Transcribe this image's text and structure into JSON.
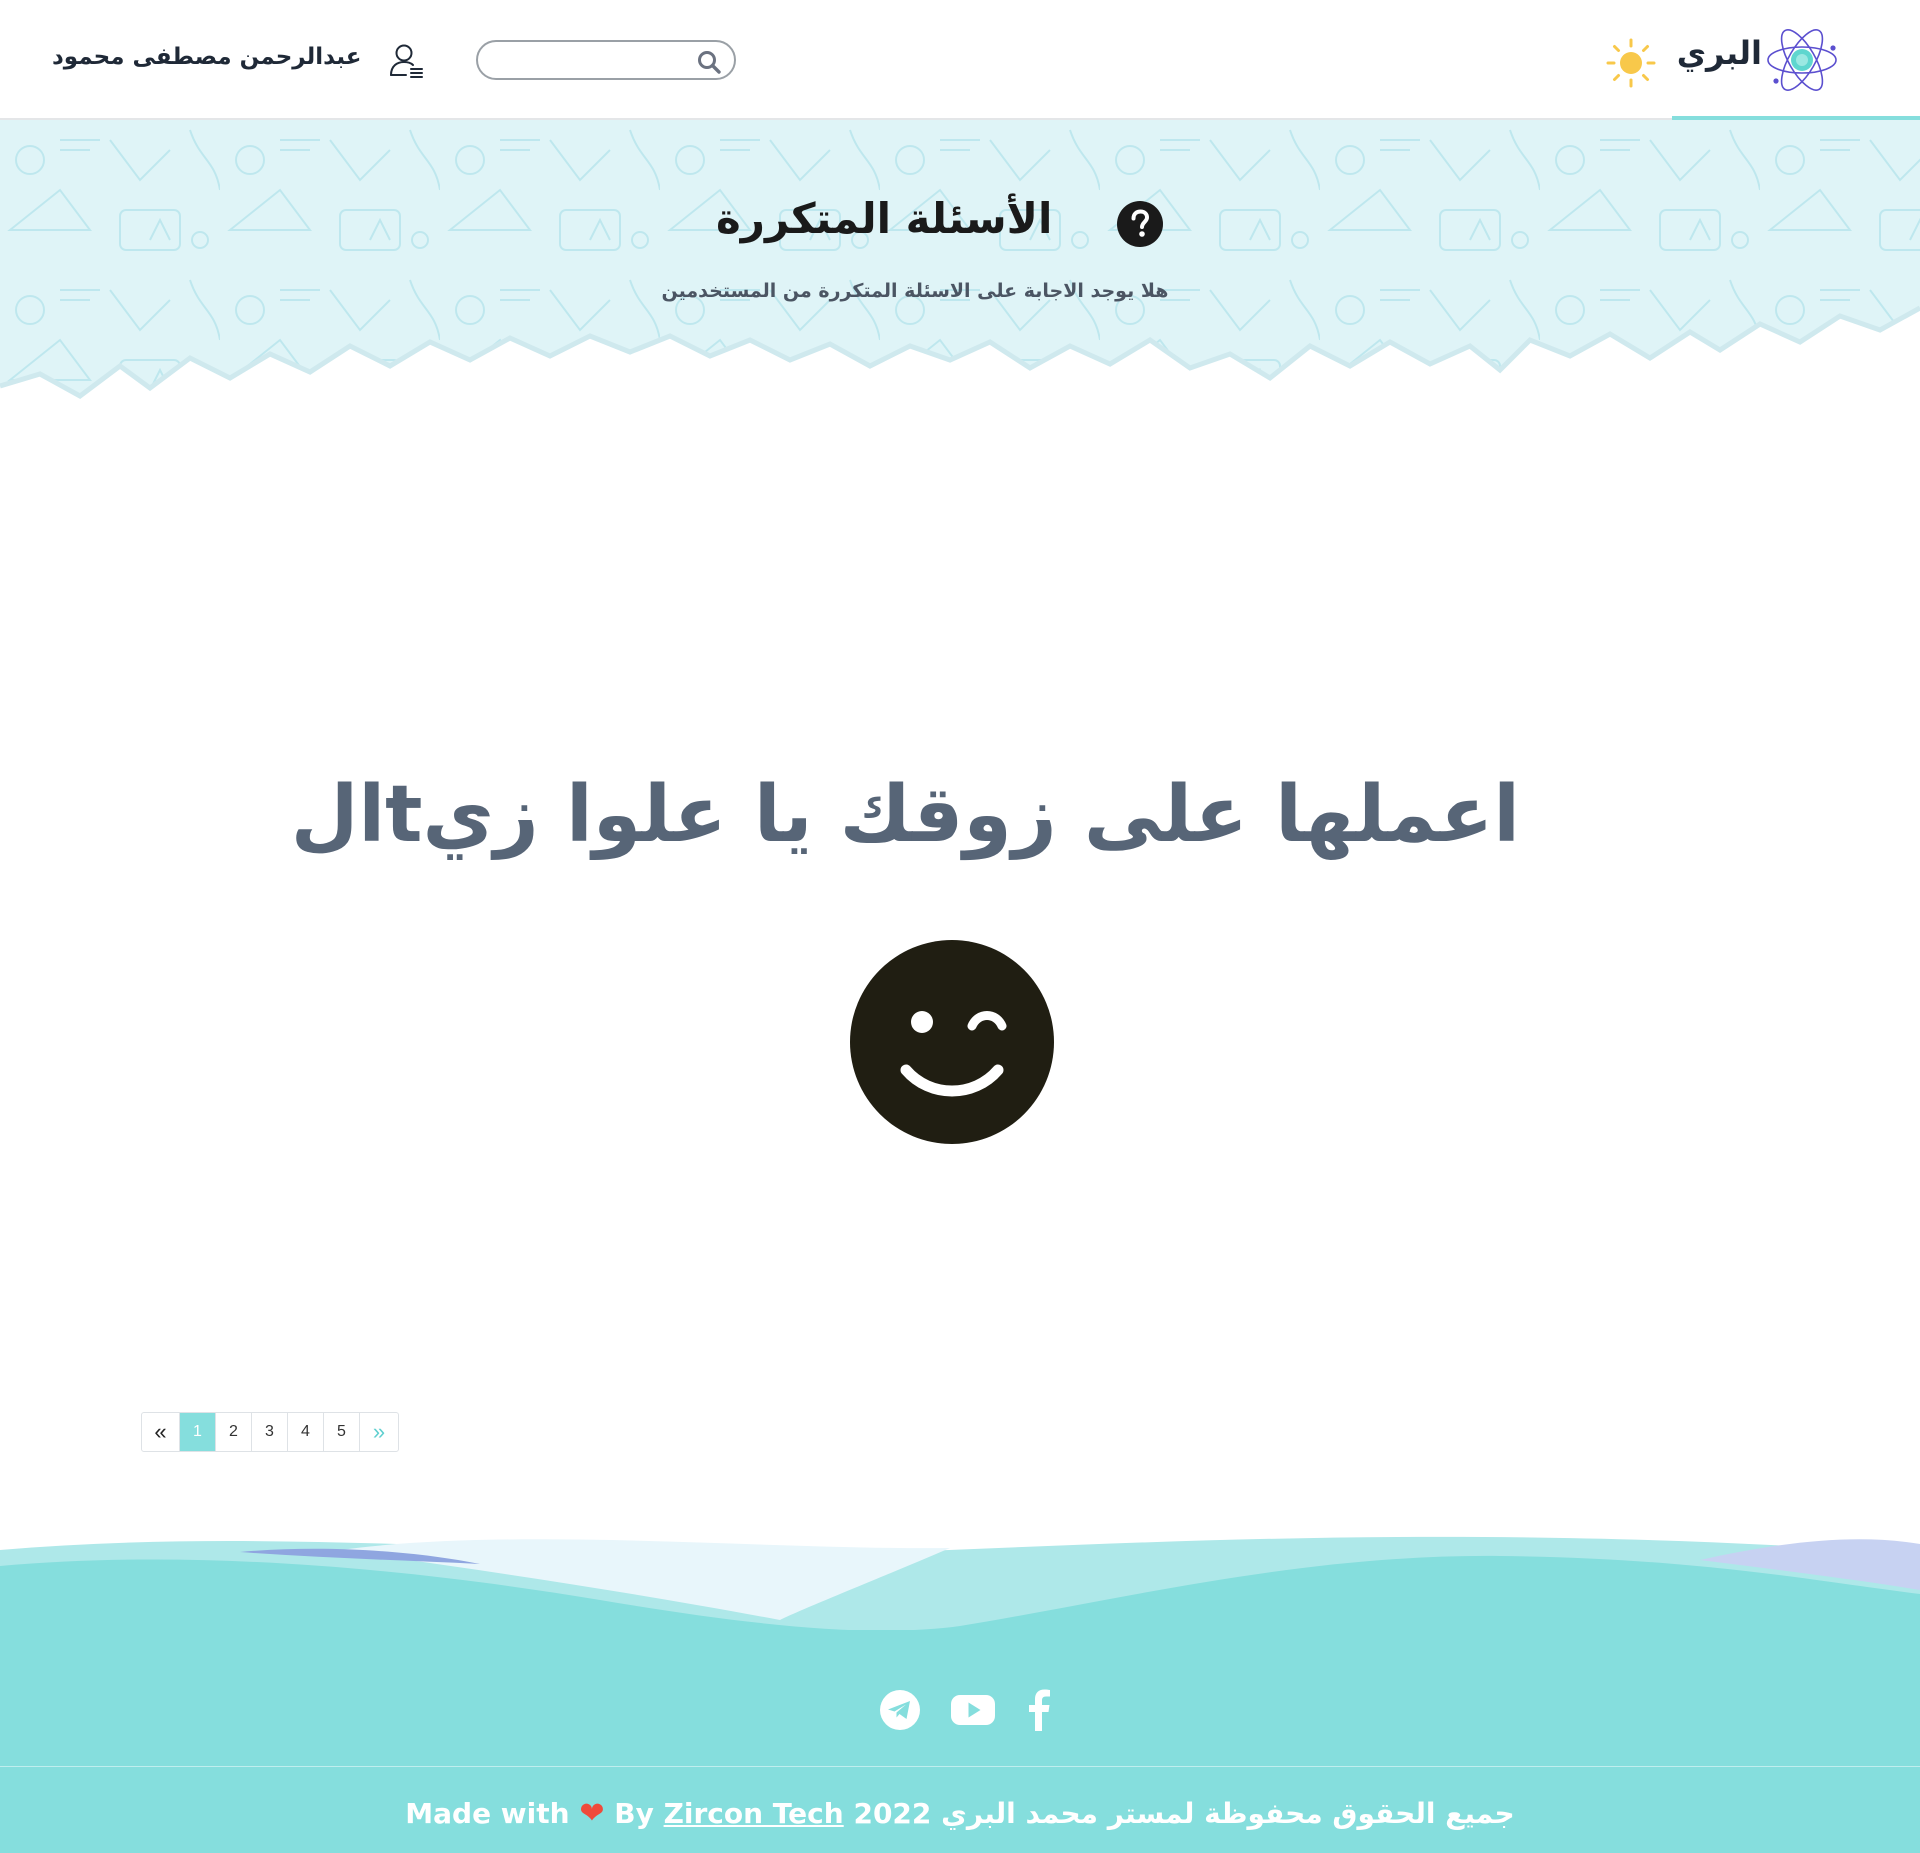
{
  "header": {
    "brand": "البري",
    "user_name": "عبدالرحمن مصطفى محمود",
    "search": {
      "placeholder": "",
      "value": ""
    },
    "icons": [
      "atom-logo-icon",
      "sun-icon",
      "search-icon",
      "user-list-icon"
    ]
  },
  "hero": {
    "title": "الأسئلة المتكررة",
    "subtitle": "هلا يوجد الاجابة على الاسئلة المتكررة من المستخدمين",
    "icon": "question-circle-icon"
  },
  "main": {
    "message": "اعملها على زوقك يا علوا زيtال",
    "emoji": "wink-face-icon"
  },
  "pagination": {
    "prev": "«",
    "pages": [
      "1",
      "2",
      "3",
      "4",
      "5"
    ],
    "active_page": "1",
    "next": "»"
  },
  "footer": {
    "social_icons": [
      "telegram-icon",
      "youtube-icon",
      "facebook-icon"
    ],
    "copyright": "جميع الحقوق محفوظة لمستر محمد البري 2022",
    "made_with": "Made with",
    "heart": "❤",
    "by": "By",
    "company": "Zircon Tech"
  },
  "colors": {
    "accent": "#85dedd",
    "hero_bg": "#dff4f7",
    "text_dark": "#1f2937",
    "message": "#576577",
    "emoji": "#201e12",
    "heart": "#ef4b3b"
  }
}
